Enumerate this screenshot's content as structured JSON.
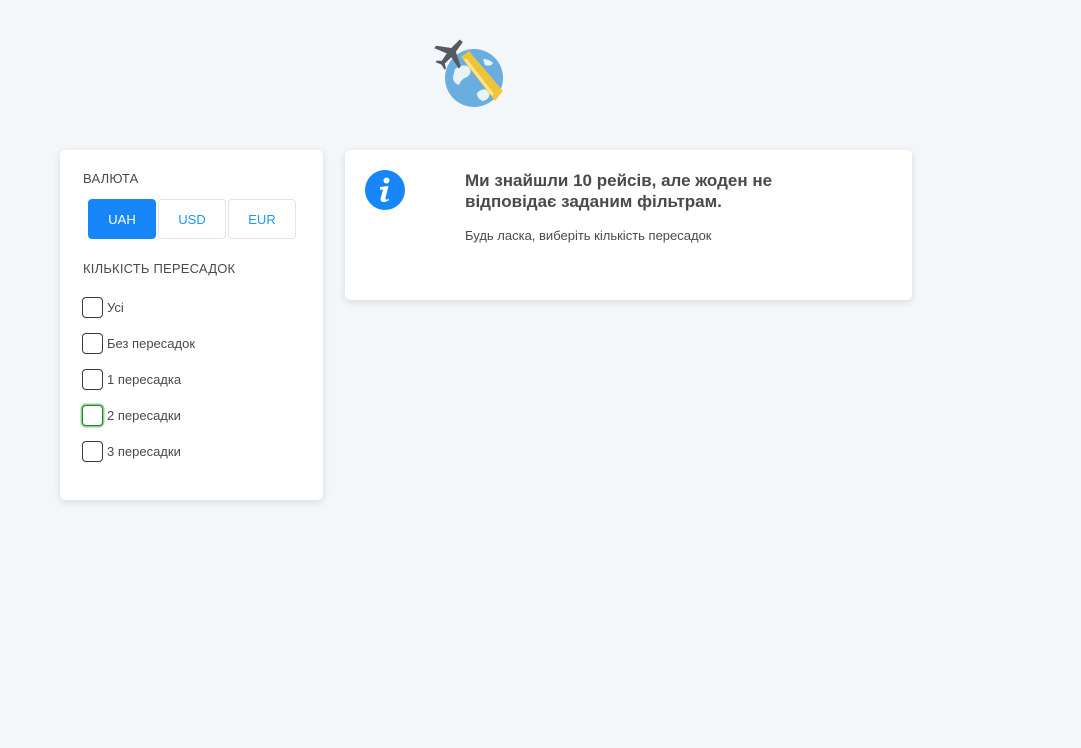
{
  "logo": {
    "icon": "plane-globe-logo"
  },
  "filters": {
    "currency_title": "ВАЛЮТА",
    "currencies": [
      {
        "label": "UAH",
        "active": true
      },
      {
        "label": "USD",
        "active": false
      },
      {
        "label": "EUR",
        "active": false
      }
    ],
    "stops_title": "КІЛЬКІСТЬ ПЕРЕСАДОК",
    "stops": [
      {
        "label": "Усі",
        "checked": false
      },
      {
        "label": "Без пересадок",
        "checked": false
      },
      {
        "label": "1 пересадка",
        "checked": false
      },
      {
        "label": "2 пересадки",
        "checked": false
      },
      {
        "label": "3 пересадки",
        "checked": false
      }
    ]
  },
  "message": {
    "icon": "info-icon",
    "title": "Ми знайшли 10 рейсів, але жоден не відповідає заданим фільтрам.",
    "text": "Будь ласка, виберіть кількість пересадок"
  },
  "colors": {
    "accent": "#1786f9",
    "background": "#f3f7fa"
  }
}
